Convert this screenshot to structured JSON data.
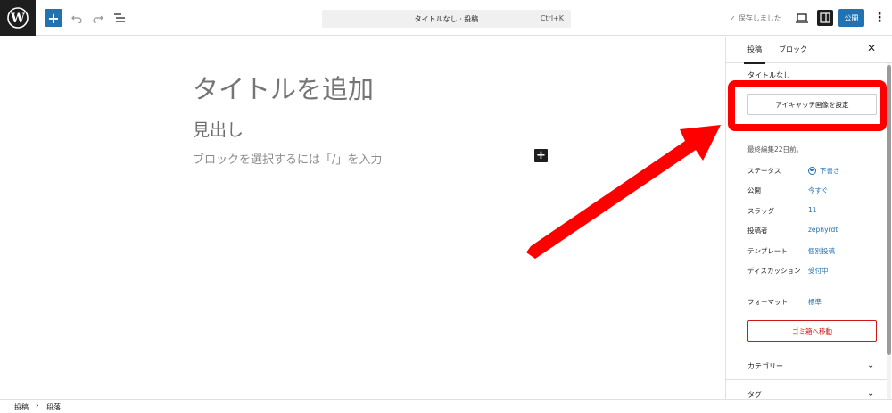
{
  "header": {
    "command_title": "タイトルなし · 投稿",
    "command_shortcut": "Ctrl+K",
    "saved_label": "保存しました",
    "publish_label": "公開",
    "accent_color": "#2271b1"
  },
  "editor": {
    "title_placeholder": "タイトルを追加",
    "heading_text": "見出し",
    "paragraph_placeholder": "ブロックを選択するには「/」を入力"
  },
  "sidebar": {
    "tabs": [
      {
        "label": "投稿",
        "active": true
      },
      {
        "label": "ブロック",
        "active": false
      }
    ],
    "post_title_row": "タイトルなし",
    "featured_image_button": "アイキャッチ画像を設定",
    "last_edited": "最終編集22日前。",
    "meta": [
      {
        "label": "ステータス",
        "value": "下書き"
      },
      {
        "label": "公開",
        "value": "今すぐ"
      },
      {
        "label": "スラッグ",
        "value": "11"
      },
      {
        "label": "投稿者",
        "value": "zephyrdt"
      },
      {
        "label": "テンプレート",
        "value": "個別投稿"
      },
      {
        "label": "ディスカッション",
        "value": "受付中"
      },
      {
        "label": "フォーマット",
        "value": "標準"
      }
    ],
    "trash_button": "ゴミ箱へ移動",
    "panels": [
      {
        "label": "カテゴリー"
      },
      {
        "label": "タグ"
      }
    ]
  },
  "footer": {
    "breadcrumb": [
      "投稿",
      "段落"
    ]
  },
  "annotation": {
    "color": "#ff0000"
  }
}
